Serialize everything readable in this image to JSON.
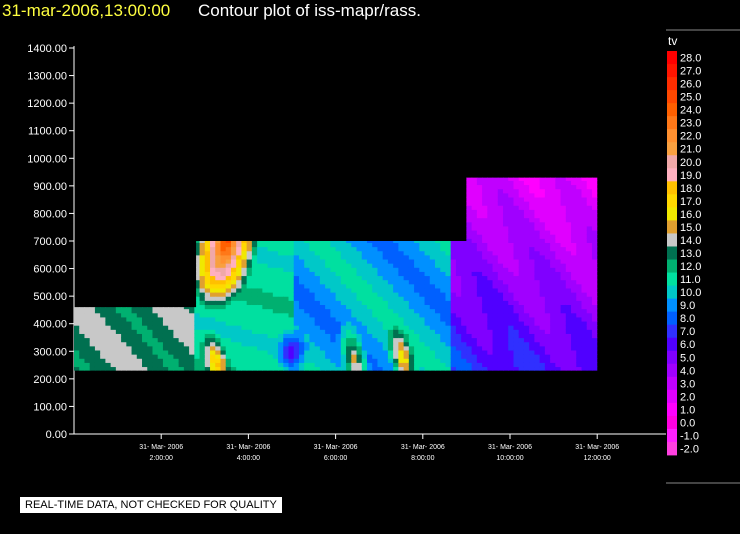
{
  "header": {
    "date": "31-mar-2006,13:00:00",
    "title": "Contour plot of iss-mapr/rass."
  },
  "note": "REAL-TIME DATA, NOT CHECKED FOR QUALITY",
  "chart_data": {
    "type": "heatmap",
    "title": "Contour plot of iss-mapr/rass.",
    "y_ticks": [
      "1400.00",
      "1300.00",
      "1200.00",
      "1100.00",
      "1000.00",
      "900.00",
      "800.00",
      "700.00",
      "600.00",
      "500.00",
      "400.00",
      "300.00",
      "200.00",
      "100.00",
      "0.00"
    ],
    "y_range": [
      0,
      1400
    ],
    "x_ticks": [
      {
        "date": "31- Mar- 2006",
        "time": "2:00:00",
        "hour": 2
      },
      {
        "date": "31- Mar- 2006",
        "time": "4:00:00",
        "hour": 4
      },
      {
        "date": "31- Mar- 2006",
        "time": "6:00:00",
        "hour": 6
      },
      {
        "date": "31- Mar- 2006",
        "time": "8:00:00",
        "hour": 8
      },
      {
        "date": "31- Mar- 2006",
        "time": "10:00:00",
        "hour": 10
      },
      {
        "date": "31- Mar- 2006",
        "time": "12:00:00",
        "hour": 12
      }
    ],
    "x_range_hours": [
      0.0,
      13.0
    ],
    "legend": {
      "variable": "tv",
      "levels": [
        "28.0",
        "27.0",
        "26.0",
        "25.0",
        "24.0",
        "23.0",
        "22.0",
        "21.0",
        "20.0",
        "19.0",
        "18.0",
        "17.0",
        "16.0",
        "15.0",
        "14.0",
        "13.0",
        "12.0",
        "11.0",
        "10.0",
        "9.0",
        "8.0",
        "7.0",
        "6.0",
        "5.0",
        "4.0",
        "3.0",
        "2.0",
        "1.0",
        "0.0",
        "-1.0",
        "-2.0"
      ],
      "colors": [
        "#ff0000",
        "#ff1500",
        "#ff2d00",
        "#ff4800",
        "#ff6000",
        "#ff7818",
        "#ff9030",
        "#f8a040",
        "#f0a8a8",
        "#ffb0c0",
        "#ffc000",
        "#ffd800",
        "#f0e800",
        "#e0a030",
        "#c8c8c8",
        "#007050",
        "#00b070",
        "#00e0a0",
        "#00c8c8",
        "#0090ff",
        "#0060ff",
        "#3030ff",
        "#5000ff",
        "#8000ff",
        "#a000ff",
        "#c000ff",
        "#e000ff",
        "#ff00ff",
        "#ff00e0",
        "#ff20ff",
        "#ff40e0"
      ]
    },
    "data_regions": [
      {
        "t0": 0.0,
        "t1": 2.8,
        "z0": 230,
        "z1": 460
      },
      {
        "t0": 2.8,
        "t1": 9.0,
        "z0": 230,
        "z1": 700
      },
      {
        "t0": 9.0,
        "t1": 12.0,
        "z0": 230,
        "z1": 930
      }
    ]
  }
}
